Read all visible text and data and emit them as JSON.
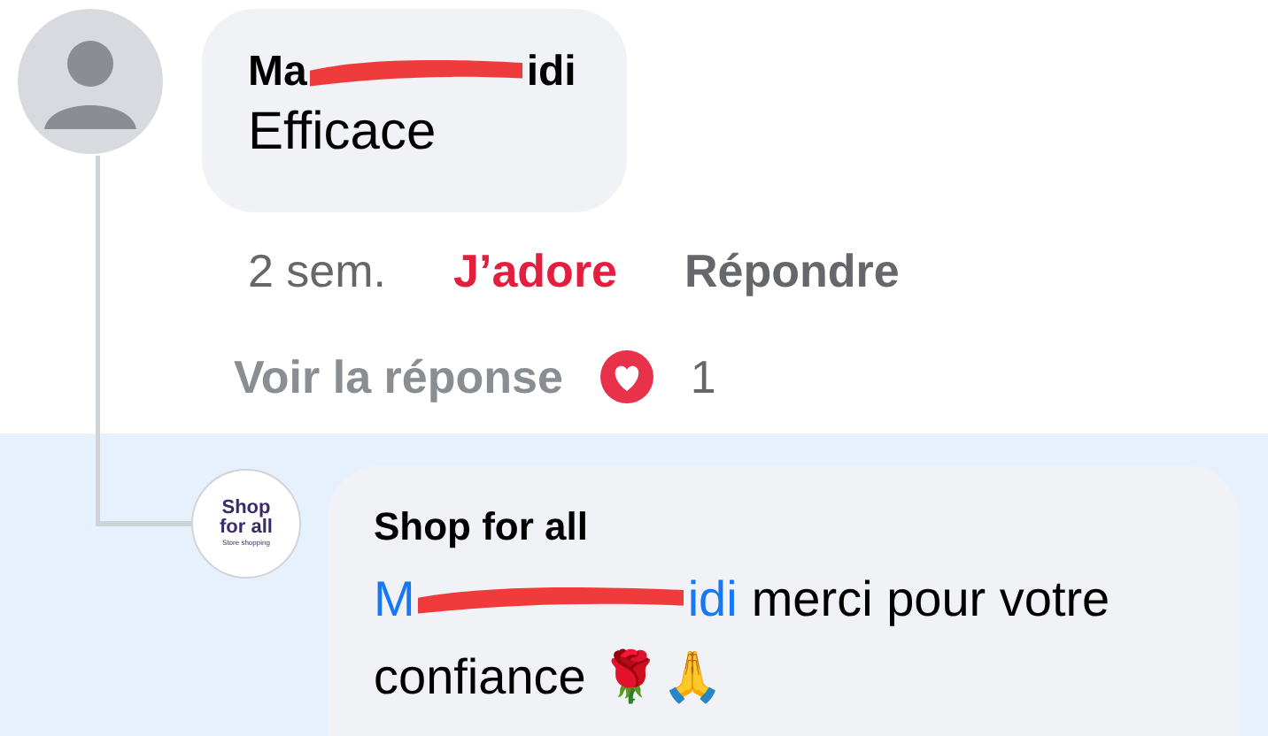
{
  "comment": {
    "author": {
      "name_start": "Ma",
      "name_end": "idi",
      "redacted": true
    },
    "text": "Efficace",
    "time": "2 sem.",
    "actions": [
      {
        "label": "J’adore",
        "selected": true
      },
      {
        "label": "Répondre",
        "selected": false
      }
    ],
    "view_replies": "Voir la réponse",
    "reaction_count": "1"
  },
  "reply": {
    "author": "Shop for all",
    "avatar_lines": [
      "Shop",
      "for all",
      "Store shopping"
    ],
    "mention": {
      "start": "M",
      "end": "idi",
      "redacted": true
    },
    "text_lines": [
      "merci pour votre",
      "confiance 🌹🙏"
    ]
  }
}
